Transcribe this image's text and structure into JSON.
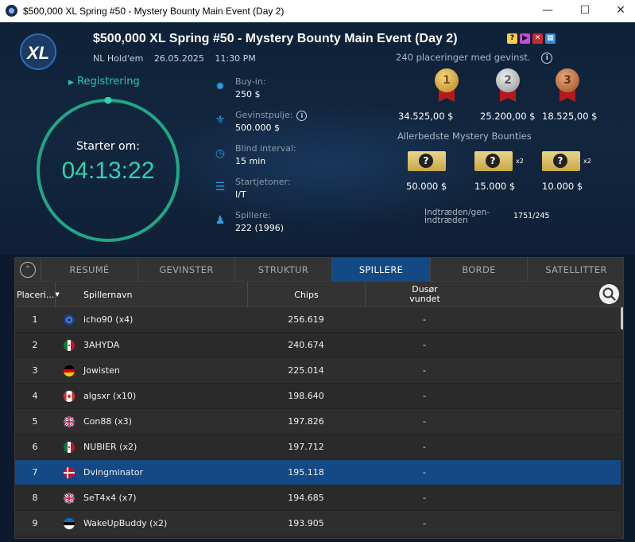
{
  "window": {
    "title": "$500,000 XL Spring #50 - Mystery Bounty Main Event (Day 2)"
  },
  "header": {
    "title": "$500,000 XL Spring #50 - Mystery Bounty Main Event (Day 2)",
    "game": "NL Hold'em",
    "date": "26.05.2025",
    "time": "11:30 PM",
    "placements": "240 placeringer med gevinst.",
    "status": "Registrering",
    "starts_label": "Starter om:",
    "countdown": "04:13:22",
    "stats": [
      {
        "key": "Buy-in:",
        "value": "250 $",
        "icon": "poker-chip-icon"
      },
      {
        "key": "Gevinstpulje:",
        "value": "500.000 $",
        "icon": "trophy-icon"
      },
      {
        "key": "Blind interval:",
        "value": "15 min",
        "icon": "clock-icon"
      },
      {
        "key": "Startjetoner:",
        "value": "I/T",
        "icon": "chip-stack-icon"
      },
      {
        "key": "Spillere:",
        "value": "222 (1996)",
        "icon": "person-icon"
      }
    ],
    "prizes": [
      {
        "rank": "1",
        "value": "34.525,00 $",
        "color": "#c9962d"
      },
      {
        "rank": "2",
        "value": "25.200,00 $",
        "color": "#a8a8a8"
      },
      {
        "rank": "3",
        "value": "18.525,00 $",
        "color": "#b06a3a"
      }
    ],
    "bounty_title": "Allerbedste Mystery Bounties",
    "bounties": [
      {
        "value": "50.000 $",
        "mult": ""
      },
      {
        "value": "15.000 $",
        "mult": "x2"
      },
      {
        "value": "10.000 $",
        "mult": "x2"
      }
    ],
    "reentry_label_1": "Indtræden/gen-",
    "reentry_label_2": "indtræden",
    "reentry_value": "1751/245"
  },
  "tabs": [
    "RESUMÉ",
    "GEVINSTER",
    "STRUKTUR",
    "SPILLERE",
    "BORDE",
    "SATELLITTER"
  ],
  "active_tab": "SPILLERE",
  "table": {
    "headers": {
      "place": "Placeri...",
      "name": "Spillernavn",
      "chips": "Chips",
      "bounty_1": "Dusør",
      "bounty_2": "vundet"
    },
    "rows": [
      {
        "place": "1",
        "name": "icho90 (x4)",
        "chips": "256.619",
        "bounty": "-",
        "flag": "globe"
      },
      {
        "place": "2",
        "name": "3AHYDA",
        "chips": "240.674",
        "bounty": "-",
        "flag": "mx"
      },
      {
        "place": "3",
        "name": "Jowisten",
        "chips": "225.014",
        "bounty": "-",
        "flag": "de"
      },
      {
        "place": "4",
        "name": "algsxr (x10)",
        "chips": "198.640",
        "bounty": "-",
        "flag": "ca"
      },
      {
        "place": "5",
        "name": "Con88 (x3)",
        "chips": "197.826",
        "bounty": "-",
        "flag": "gb"
      },
      {
        "place": "6",
        "name": "NUBIER (x2)",
        "chips": "197.712",
        "bounty": "-",
        "flag": "mx"
      },
      {
        "place": "7",
        "name": "Dvingminator",
        "chips": "195.118",
        "bounty": "-",
        "flag": "dk"
      },
      {
        "place": "8",
        "name": "SeT4x4 (x7)",
        "chips": "194.685",
        "bounty": "-",
        "flag": "gb"
      },
      {
        "place": "9",
        "name": "WakeUpBuddy (x2)",
        "chips": "193.905",
        "bounty": "-",
        "flag": "ee"
      }
    ],
    "selected_row": 6
  },
  "colors": {
    "accent": "#2bd6ac",
    "tab_active": "#134a85",
    "header_bg": "#0f2138"
  }
}
